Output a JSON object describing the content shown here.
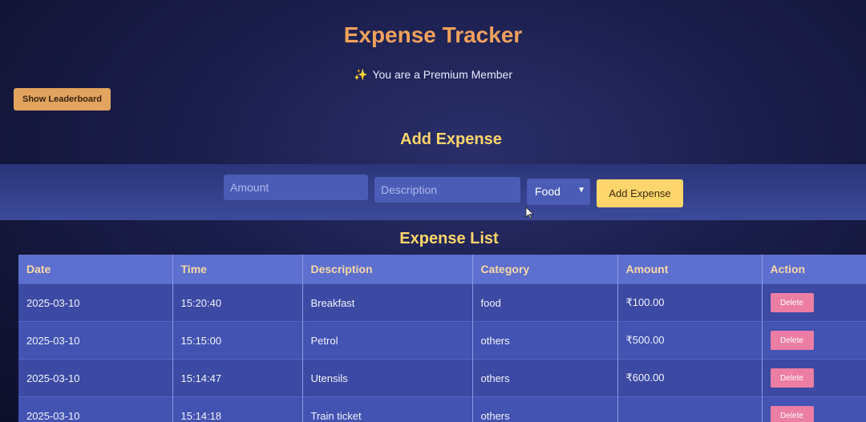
{
  "header": {
    "title": "Expense Tracker",
    "premium_text": "You are a Premium Member",
    "premium_icon": "sparkle-icon"
  },
  "leaderboard": {
    "label": "Show Leaderboard"
  },
  "add_section": {
    "heading": "Add Expense",
    "amount_placeholder": "Amount",
    "description_placeholder": "Description",
    "category_selected": "Food",
    "add_button": "Add Expense"
  },
  "list_section": {
    "heading": "Expense List",
    "columns": [
      "Date",
      "Time",
      "Description",
      "Category",
      "Amount",
      "Action"
    ],
    "rows": [
      {
        "date": "2025-03-10",
        "time": "15:20:40",
        "description": "Breakfast",
        "category": "food",
        "amount": "₹100.00",
        "action": "Delete"
      },
      {
        "date": "2025-03-10",
        "time": "15:15:00",
        "description": "Petrol",
        "category": "others",
        "amount": "₹500.00",
        "action": "Delete"
      },
      {
        "date": "2025-03-10",
        "time": "15:14:47",
        "description": "Utensils",
        "category": "others",
        "amount": "₹600.00",
        "action": "Delete"
      },
      {
        "date": "2025-03-10",
        "time": "15:14:18",
        "description": "Train ticket",
        "category": "others",
        "amount": "",
        "action": "Delete"
      }
    ]
  },
  "colors": {
    "title": "#f0a15c",
    "heading": "#ffd66b",
    "delete": "#ec7da3",
    "add_button": "#ffd66b",
    "leaderboard_button": "#e2a45f"
  }
}
